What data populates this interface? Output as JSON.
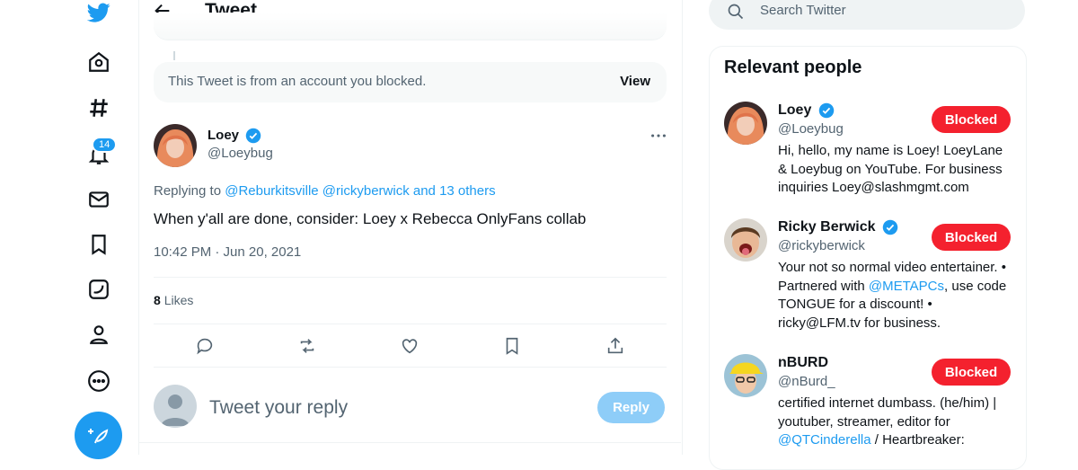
{
  "header": {
    "title": "Tweet"
  },
  "nav": {
    "notifications_count": "14"
  },
  "blocked_notice": {
    "text": "This Tweet is from an account you blocked.",
    "view_label": "View"
  },
  "tweet": {
    "author_name": "Loey",
    "author_handle": "@Loeybug",
    "replying_prefix": "Replying to",
    "replying_targets": "@Reburkitsville @rickyberwick and 13 others",
    "text": "When y'all are done, consider: Loey x Rebecca OnlyFans collab",
    "timestamp": "10:42 PM · Jun 20, 2021",
    "likes_count": "8",
    "likes_label": "Likes"
  },
  "reply": {
    "placeholder": "Tweet your reply",
    "button_label": "Reply"
  },
  "search": {
    "placeholder": "Search Twitter"
  },
  "relevant": {
    "title": "Relevant people",
    "people": [
      {
        "name": "Loey",
        "handle": "@Loeybug",
        "button": "Blocked",
        "bio_1": "Hi, hello, my name is Loey! LoeyLane & Loeybug on YouTube. For business inquiries Loey@slashmgmt.com"
      },
      {
        "name": "Ricky Berwick",
        "handle": "@rickyberwick",
        "button": "Blocked",
        "bio_1": "Your not so normal video entertainer. • Partnered with ",
        "bio_link": "@METAPCs",
        "bio_2": ", use code TONGUE for a discount! • ricky@LFM.tv for business."
      },
      {
        "name": "nBURD",
        "handle": "@nBurd_",
        "button": "Blocked",
        "bio_1": "certified internet dumbass. (he/him) | youtuber, streamer, editor for ",
        "bio_link": "@QTCinderella",
        "bio_2": " / Heartbreaker:"
      }
    ]
  },
  "colors": {
    "accent": "#1d9bf0",
    "blocked": "#f4212e",
    "muted": "#536471"
  }
}
